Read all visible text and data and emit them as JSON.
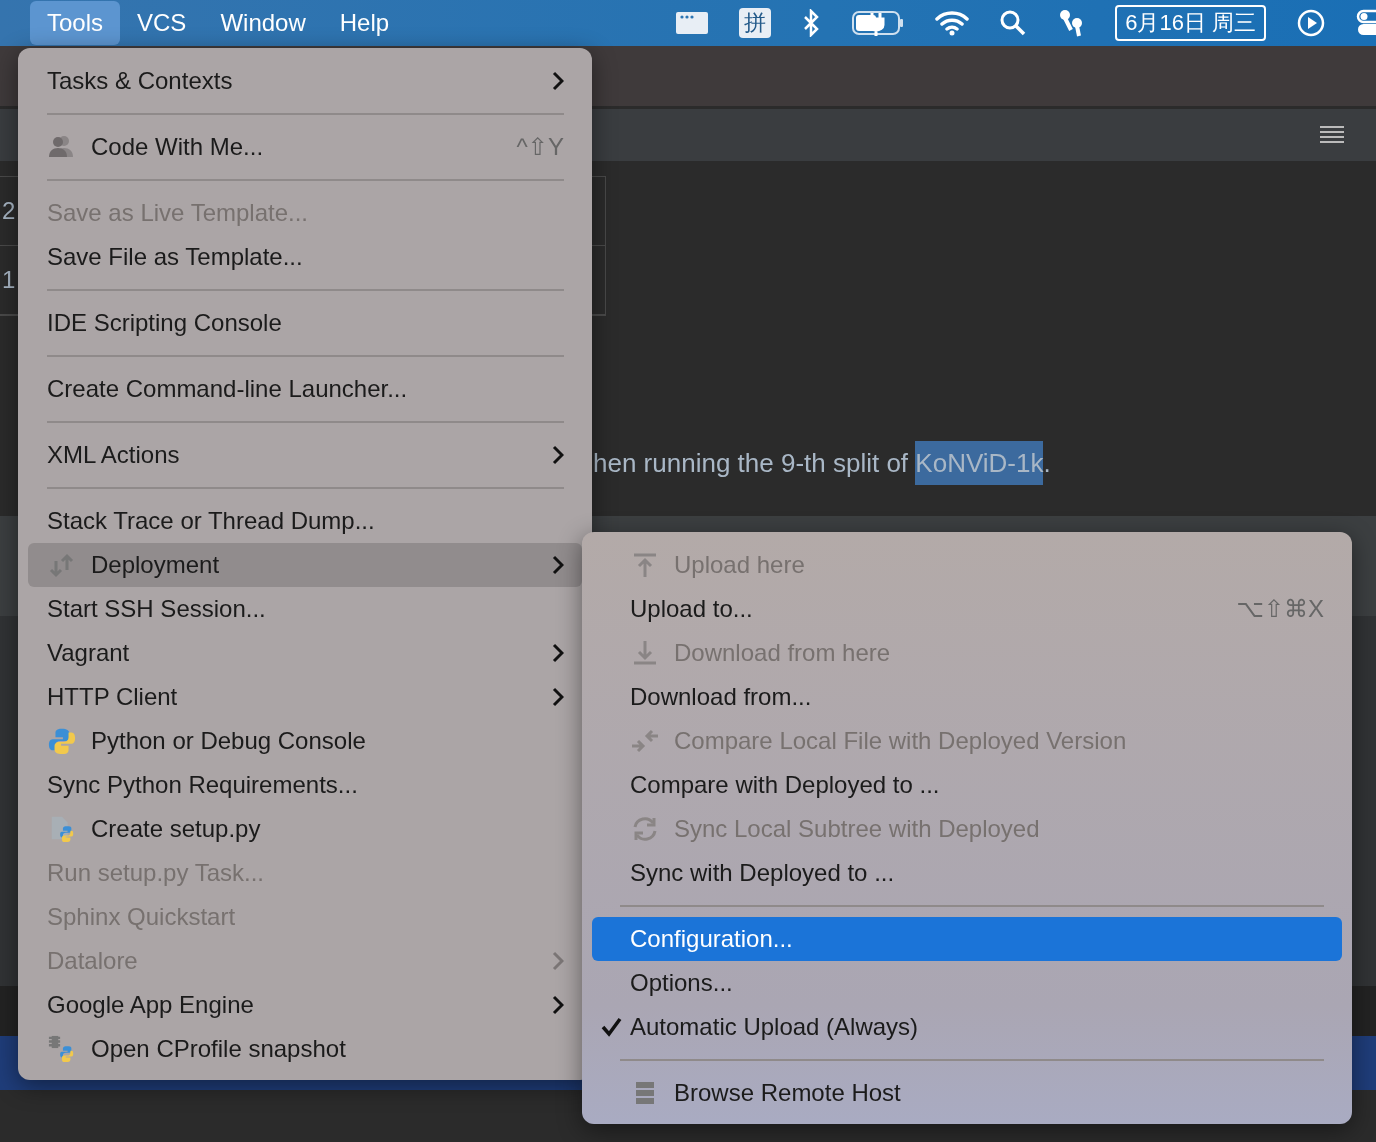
{
  "menubar": {
    "items": [
      {
        "label": "Tools",
        "selected": true
      },
      {
        "label": "VCS",
        "selected": false
      },
      {
        "label": "Window",
        "selected": false
      },
      {
        "label": "Help",
        "selected": false
      }
    ],
    "input_method": "拼",
    "date": "6月16日 周三"
  },
  "editor": {
    "gutter_numbers": [
      "2",
      "1"
    ],
    "line_text": "hen running the 9-th split of ",
    "selected_text": "KoNViD-1k",
    "line_end": "."
  },
  "tools_menu": [
    {
      "kind": "item",
      "label": "Tasks & Contexts",
      "disabled": false,
      "submenu": true,
      "selected": false
    },
    {
      "kind": "separator"
    },
    {
      "kind": "collab",
      "label": "Code With Me...",
      "shortcut": "^⇧Y",
      "disabled": false,
      "submenu": false,
      "selected": false
    },
    {
      "kind": "separator"
    },
    {
      "kind": "item",
      "label": "Save as Live Template...",
      "disabled": true,
      "submenu": false,
      "selected": false
    },
    {
      "kind": "item",
      "label": "Save File as Template...",
      "disabled": false,
      "submenu": false,
      "selected": false
    },
    {
      "kind": "separator"
    },
    {
      "kind": "item",
      "label": "IDE Scripting Console",
      "disabled": false,
      "submenu": false,
      "selected": false
    },
    {
      "kind": "separator"
    },
    {
      "kind": "item",
      "label": "Create Command-line Launcher...",
      "disabled": false,
      "submenu": false,
      "selected": false
    },
    {
      "kind": "separator"
    },
    {
      "kind": "item",
      "label": "XML Actions",
      "disabled": false,
      "submenu": true,
      "selected": false
    },
    {
      "kind": "separator"
    },
    {
      "kind": "item",
      "label": "Stack Trace or Thread Dump...",
      "disabled": false,
      "submenu": false,
      "selected": false
    },
    {
      "kind": "deploy",
      "label": "Deployment",
      "disabled": false,
      "submenu": true,
      "selected": true
    },
    {
      "kind": "item",
      "label": "Start SSH Session...",
      "disabled": false,
      "submenu": false,
      "selected": false
    },
    {
      "kind": "item",
      "label": "Vagrant",
      "disabled": false,
      "submenu": true,
      "selected": false
    },
    {
      "kind": "item",
      "label": "HTTP Client",
      "disabled": false,
      "submenu": true,
      "selected": false
    },
    {
      "kind": "python",
      "label": "Python or Debug Console",
      "disabled": false,
      "submenu": false,
      "selected": false
    },
    {
      "kind": "item",
      "label": "Sync Python Requirements...",
      "disabled": false,
      "submenu": false,
      "selected": false
    },
    {
      "kind": "setup",
      "label": "Create setup.py",
      "disabled": false,
      "submenu": false,
      "selected": false
    },
    {
      "kind": "item",
      "label": "Run setup.py Task...",
      "disabled": true,
      "submenu": false,
      "selected": false
    },
    {
      "kind": "item",
      "label": "Sphinx Quickstart",
      "disabled": true,
      "submenu": false,
      "selected": false
    },
    {
      "kind": "item",
      "label": "Datalore",
      "disabled": true,
      "submenu": true,
      "selected": false
    },
    {
      "kind": "item",
      "label": "Google App Engine",
      "disabled": false,
      "submenu": true,
      "selected": false
    },
    {
      "kind": "profiler",
      "label": "Open CProfile snapshot",
      "disabled": false,
      "submenu": false,
      "selected": false
    }
  ],
  "deployment_menu": [
    {
      "kind": "upload",
      "label": "Upload here",
      "disabled": true,
      "selected": false,
      "checked": false
    },
    {
      "kind": "item",
      "label": "Upload to...",
      "shortcut": "⌥⇧⌘X",
      "disabled": false,
      "selected": false,
      "checked": false
    },
    {
      "kind": "download",
      "label": "Download from here",
      "disabled": true,
      "selected": false,
      "checked": false
    },
    {
      "kind": "item",
      "label": "Download from...",
      "disabled": false,
      "selected": false,
      "checked": false
    },
    {
      "kind": "compare",
      "label": "Compare Local File with Deployed Version",
      "disabled": true,
      "selected": false,
      "checked": false
    },
    {
      "kind": "item",
      "label": "Compare with Deployed to ...",
      "disabled": false,
      "selected": false,
      "checked": false
    },
    {
      "kind": "sync",
      "label": "Sync Local Subtree with Deployed",
      "disabled": true,
      "selected": false,
      "checked": false
    },
    {
      "kind": "item",
      "label": "Sync with Deployed to ...",
      "disabled": false,
      "selected": false,
      "checked": false
    },
    {
      "kind": "separator"
    },
    {
      "kind": "item",
      "label": "Configuration...",
      "disabled": false,
      "selected": true,
      "checked": false
    },
    {
      "kind": "item",
      "label": "Options...",
      "disabled": false,
      "selected": false,
      "checked": false
    },
    {
      "kind": "item",
      "label": "Automatic Upload (Always)",
      "disabled": false,
      "selected": false,
      "checked": true
    },
    {
      "kind": "separator"
    },
    {
      "kind": "server",
      "label": "Browse Remote Host",
      "disabled": false,
      "selected": false,
      "checked": false
    }
  ]
}
